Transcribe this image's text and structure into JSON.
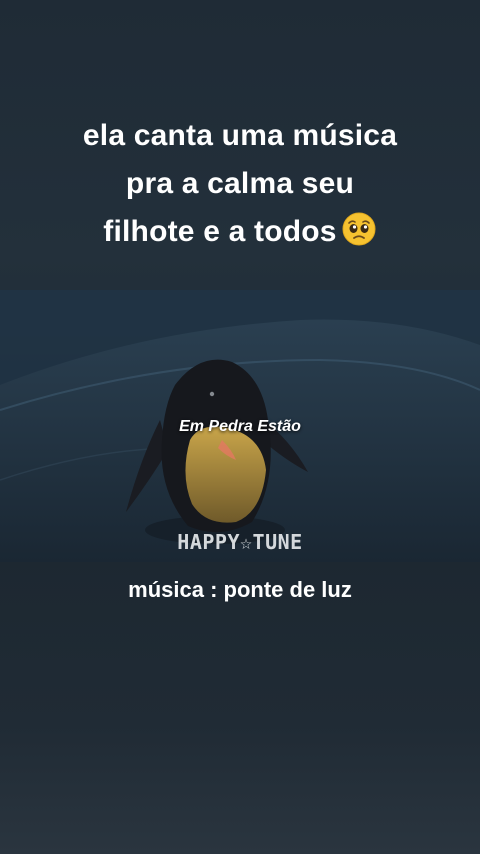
{
  "caption": {
    "line1": "ela canta uma música",
    "line2": "pra a calma seu",
    "line3": "filhote e a todos",
    "emoji_icon": "pleading-face-emoji"
  },
  "video": {
    "lyric": "Em Pedra Estão",
    "watermark": "HAPPY☆TUNE"
  },
  "footer": {
    "music_label": "música : ponte de luz"
  }
}
